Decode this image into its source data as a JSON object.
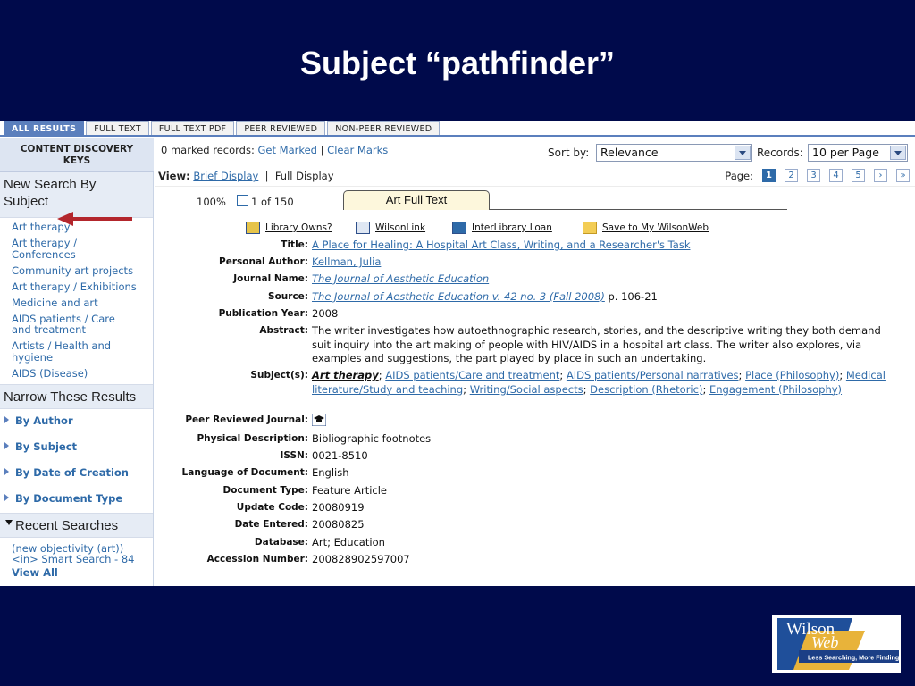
{
  "slide": {
    "title": "Subject “pathfinder”"
  },
  "tabs": [
    "ALL RESULTS",
    "FULL TEXT",
    "FULL TEXT PDF",
    "PEER REVIEWED",
    "NON-PEER REVIEWED"
  ],
  "sidebar": {
    "cdk_title": "CONTENT DISCOVERY KEYS",
    "new_search_head": "New Search By Subject",
    "subjects": [
      "Art therapy",
      "Art therapy / Conferences",
      "Community art projects",
      "Art therapy / Exhibitions",
      "Medicine and art",
      "AIDS patients / Care and treatment",
      "Artists / Health and hygiene",
      "AIDS (Disease)"
    ],
    "narrow_head": "Narrow These Results",
    "narrow_items": [
      "By Author",
      "By Subject",
      "By Date of Creation",
      "By Document Type"
    ],
    "recent_head": "Recent Searches",
    "recent_item": "(new objectivity (art)) <in> Smart Search - 84",
    "recent_more": "View All"
  },
  "toolbar": {
    "marked_prefix": "0 marked records:",
    "get_marked": "Get Marked",
    "sep": "|",
    "clear_marks": "Clear Marks",
    "sort_label": "Sort by:",
    "sort_value": "Relevance",
    "records_label": "Records:",
    "records_value": "10 per Page"
  },
  "view": {
    "label": "View:",
    "brief": "Brief Display",
    "sep": "|",
    "full": "Full Display",
    "page_label": "Page:",
    "pages": [
      "1",
      "2",
      "3",
      "4",
      "5",
      "›",
      "»"
    ]
  },
  "record_bar": {
    "zoom": "100%",
    "count": "1 of 150",
    "full_text_tab": "Art Full Text"
  },
  "actions": [
    "Library Owns?",
    "WilsonLink",
    "InterLibrary Loan",
    "Save to My WilsonWeb"
  ],
  "record": {
    "title_k": "Title:",
    "title_v": "A Place for Healing: A Hospital Art Class, Writing, and a Researcher's Task",
    "author_k": "Personal Author:",
    "author_v": "Kellman, Julia",
    "journal_k": "Journal Name:",
    "journal_v": "The Journal of Aesthetic Education",
    "source_k": "Source:",
    "source_link": "The Journal of Aesthetic Education v. 42 no. 3 (Fall 2008)",
    "source_pages": "p. 106-21",
    "year_k": "Publication Year:",
    "year_v": "2008",
    "abstract_k": "Abstract:",
    "abstract_v": "The writer investigates how autoethnographic research, stories, and the descriptive writing they both demand suit inquiry into the art making of people with HIV/AIDS in a hospital art class. The writer also explores, via examples and suggestions, the part played by place in such an undertaking.",
    "subjects_k": "Subject(s):",
    "subjects_v": [
      "Art therapy",
      "AIDS patients/Care and treatment",
      "AIDS patients/Personal narratives",
      "Place (Philosophy)",
      "Medical literature/Study and teaching",
      "Writing/Social aspects",
      "Description (Rhetoric)",
      "Engagement (Philosophy)"
    ],
    "peer_k": "Peer Reviewed Journal:",
    "phys_k": "Physical Description:",
    "phys_v": "Bibliographic footnotes",
    "issn_k": "ISSN:",
    "issn_v": "0021-8510",
    "lang_k": "Language of Document:",
    "lang_v": "English",
    "doctype_k": "Document Type:",
    "doctype_v": "Feature Article",
    "update_k": "Update Code:",
    "update_v": "20080919",
    "entered_k": "Date Entered:",
    "entered_v": "20080825",
    "db_k": "Database:",
    "db_v": "Art; Education",
    "acc_k": "Accession Number:",
    "acc_v": "200828902597007"
  },
  "logo": {
    "name_top": "Wilson",
    "name_bottom": "Web",
    "tagline": "Less Searching, More Finding"
  }
}
